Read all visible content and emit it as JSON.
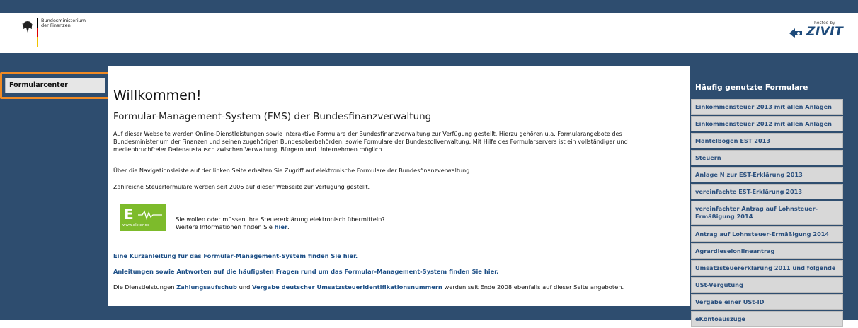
{
  "header": {
    "ministry_line1": "Bundesministerium",
    "ministry_line2": "der Finanzen",
    "hosted_by": "hosted by",
    "zivit": "ZIVIT"
  },
  "nav": {
    "items": [
      {
        "label": "Formularcenter"
      }
    ]
  },
  "main": {
    "welcome": "Willkommen!",
    "title": "Formular-Management-System (FMS) der Bundesfinanzverwaltung",
    "p1": "Auf dieser Webseite werden Online-Dienstleistungen sowie interaktive Formulare der Bundesfinanzverwaltung zur Verfügung gestellt. Hierzu gehören u.a. Formularangebote des Bundesministerium der Finanzen und seinen zugehörigen Bundesoberbehörden, sowie Formulare der Bundeszollverwaltung. Mit Hilfe des Formularservers ist ein vollständiger und medienbruchfreier Datenaustausch zwischen Verwaltung, Bürgern und Unternehmen möglich.",
    "p2": "Über die Navigationsleiste auf der linken Seite erhalten Sie Zugriff auf elektronische Formulare der Bundesfinanzverwaltung.",
    "p3": "Zahlreiche Steuerformulare werden seit 2006 auf dieser Webseite zur Verfügung gestellt.",
    "elster": {
      "logo_url": "www.elster.de",
      "line1": "Sie wollen oder müssen Ihre Steuererklärung elektronisch übermitteln?",
      "line2_prefix": "Weitere Informationen finden Sie ",
      "line2_link": "hier",
      "line2_suffix": "."
    },
    "kurzanleitung": "Eine Kurzanleitung für das Formular-Management-System finden Sie hier.",
    "anleitungen": "Anleitungen sowie Antworten auf die häufigsten Fragen rund um das Formular-Management-System finden Sie hier.",
    "dienst": {
      "prefix": "Die Dienstleistungen ",
      "link1": "Zahlungsaufschub",
      "middle": " und ",
      "link2": "Vergabe deutscher Umsatzsteueridentifikationsnummern",
      "suffix": " werden seit Ende 2008 ebenfalls auf dieser Seite angeboten."
    }
  },
  "sidebar": {
    "title": "Häufig genutzte Formulare",
    "items": [
      {
        "label": "Einkommensteuer 2013 mit allen Anlagen"
      },
      {
        "label": "Einkommensteuer 2012 mit allen Anlagen"
      },
      {
        "label": "Mantelbogen EST 2013"
      },
      {
        "label": "Steuern"
      },
      {
        "label": "Anlage N zur EST-Erklärung 2013"
      },
      {
        "label": "vereinfachte EST-Erklärung 2013"
      },
      {
        "label": "vereinfachter Antrag auf Lohnsteuer-Ermäßigung 2014"
      },
      {
        "label": "Antrag auf Lohnsteuer-Ermäßigung 2014"
      },
      {
        "label": "Agrardieselonlineantrag"
      },
      {
        "label": "Umsatzsteuererklärung 2011 und folgende"
      },
      {
        "label": "USt-Vergütung"
      },
      {
        "label": "Vergabe einer USt-ID"
      },
      {
        "label": "eKontoauszüge"
      }
    ]
  },
  "colors": {
    "brand_blue": "#2e4d6f",
    "link": "#1d4f86",
    "highlight": "#f08a24",
    "elster_green": "#7dbb2b"
  }
}
